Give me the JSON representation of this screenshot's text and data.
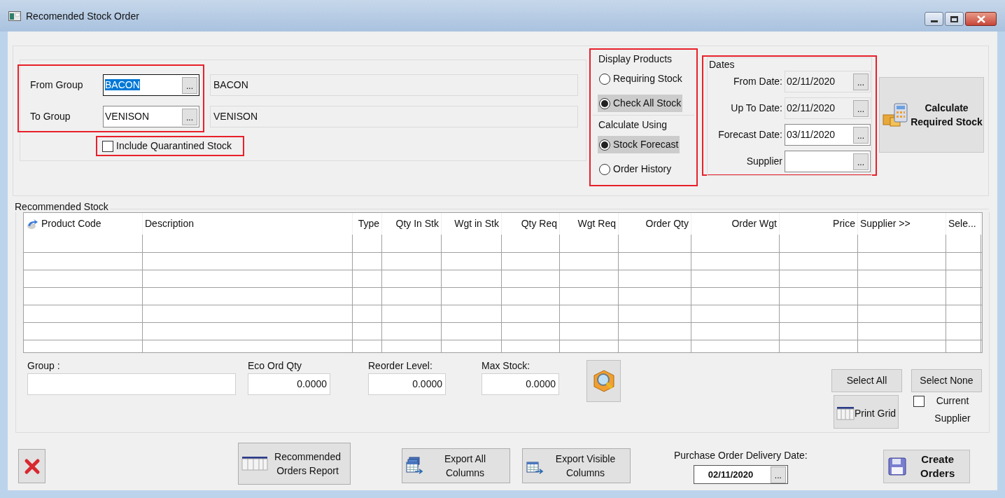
{
  "window": {
    "title": "Recomended Stock Order"
  },
  "group_range": {
    "highlighted": true,
    "rows": [
      {
        "label": "From Group",
        "value": "BACON",
        "text_selected": true,
        "button": "...",
        "description": "BACON"
      },
      {
        "label": "To Group",
        "value": "VENISON",
        "text_selected": false,
        "button": "...",
        "description": "VENISON"
      }
    ]
  },
  "include_quarantined": {
    "label": "Include Quarantined Stock",
    "checked": false,
    "highlighted": true
  },
  "options": {
    "highlighted": true,
    "groups": [
      {
        "title": "Display Products",
        "options": [
          {
            "label": "Requiring Stock",
            "selected": false
          },
          {
            "label": "Check All Stock",
            "selected": true
          }
        ]
      },
      {
        "title": "Calculate Using",
        "options": [
          {
            "label": "Stock Forecast",
            "selected": true
          },
          {
            "label": "Order History",
            "selected": false
          }
        ]
      }
    ]
  },
  "dates": {
    "title": "Dates",
    "highlighted": true,
    "fields": [
      {
        "label": "From Date:",
        "value": "02/11/2020",
        "disabled": true,
        "button": "..."
      },
      {
        "label": "Up To Date:",
        "value": "02/11/2020",
        "disabled": true,
        "button": "..."
      },
      {
        "label": "Forecast Date:",
        "value": "03/11/2020",
        "disabled": false,
        "button": "..."
      },
      {
        "label": "Supplier",
        "disabled": false,
        "button": "..."
      }
    ]
  },
  "calculate_button": {
    "label": "Calculate Required Stock"
  },
  "recommended_stock": {
    "title": "Recommended Stock",
    "columns": [
      {
        "label": "Product Code",
        "kind": "text"
      },
      {
        "label": "Description",
        "kind": "text"
      },
      {
        "label": "Type",
        "kind": "number"
      },
      {
        "label": "Qty In Stk",
        "kind": "number"
      },
      {
        "label": "Wgt in Stk",
        "kind": "number"
      },
      {
        "label": "Qty Req",
        "kind": "number"
      },
      {
        "label": "Wgt Req",
        "kind": "number"
      },
      {
        "label": "Order Qty",
        "kind": "number"
      },
      {
        "label": "Order Wgt",
        "kind": "number"
      },
      {
        "label": "Price",
        "kind": "number"
      },
      {
        "label": "Supplier >>",
        "kind": "text"
      },
      {
        "label": "Sele...",
        "kind": "text"
      }
    ]
  },
  "details": [
    {
      "label": "Group :",
      "kind": "text"
    },
    {
      "label": "Eco Ord Qty",
      "value": "0.0000",
      "kind": "number"
    },
    {
      "label": "Reorder Level:",
      "value": "0.0000",
      "kind": "number"
    },
    {
      "label": "Max Stock:",
      "value": "0.0000",
      "kind": "number"
    }
  ],
  "select_all": {
    "label": "Select All"
  },
  "select_none": {
    "label": "Select None"
  },
  "print_grid": {
    "label": "Print Grid"
  },
  "current_supplier": {
    "label": "Current Supplier",
    "checked": false
  },
  "footer": {
    "buttons": [
      {
        "kind": "cancel"
      },
      {
        "kind": "report",
        "label": "Recommended Orders Report"
      },
      {
        "kind": "export_all",
        "label": "Export All Columns"
      },
      {
        "kind": "export_visible",
        "label": "Export Visible Columns"
      }
    ],
    "delivery_date": {
      "label": "Purchase Order Delivery Date:",
      "value": "02/11/2020",
      "button": "..."
    },
    "create_button": {
      "label": "Create Orders"
    }
  }
}
